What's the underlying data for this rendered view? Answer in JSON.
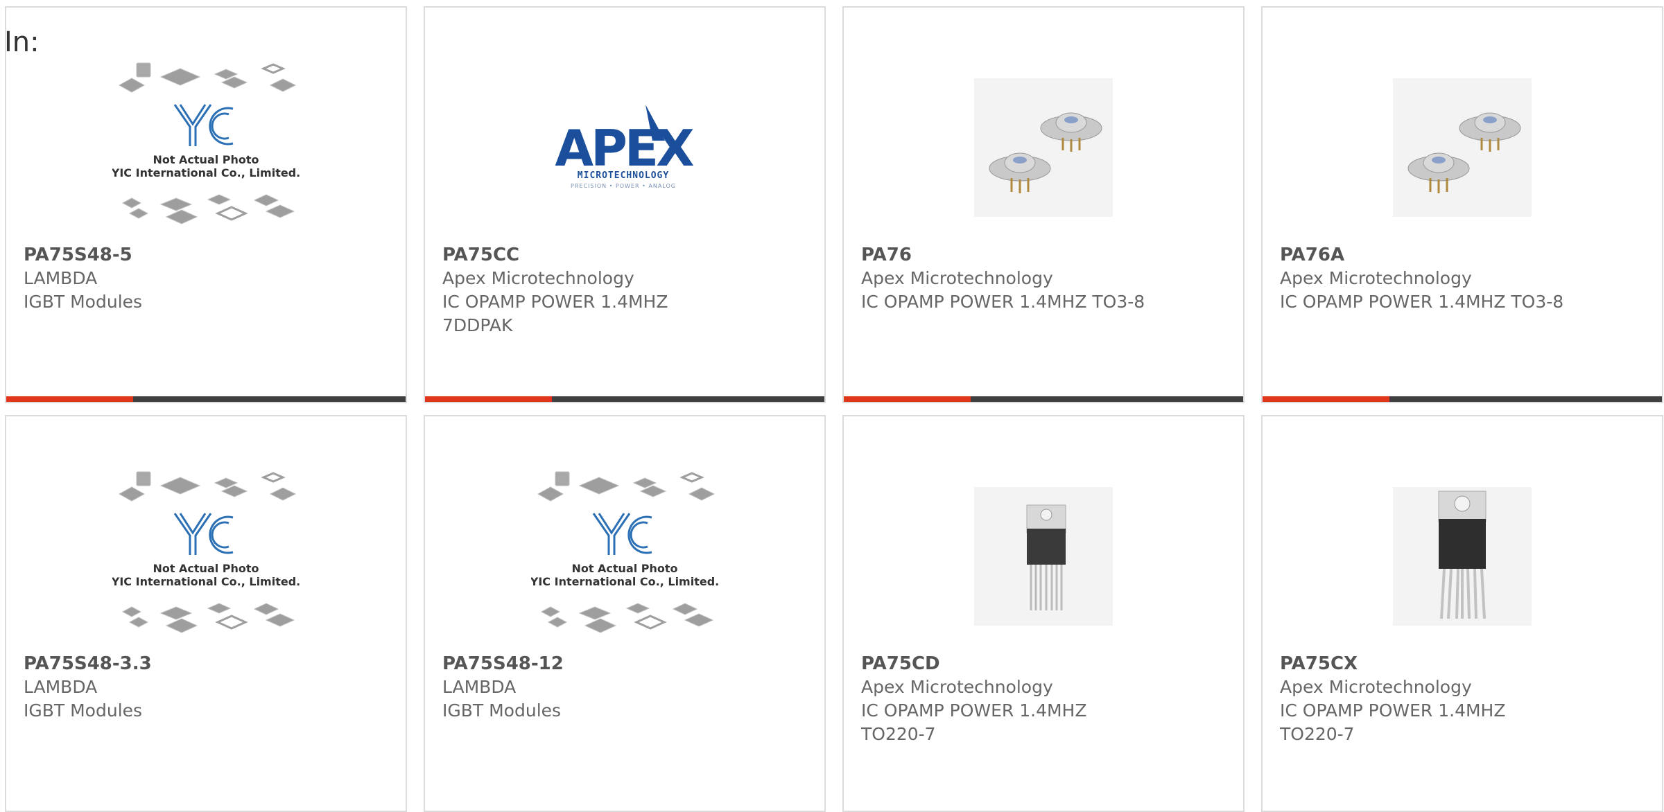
{
  "page": {
    "label": "In:"
  },
  "theme": {
    "accent": "#e2361c",
    "bar": "#404040",
    "border": "#dcdcdc",
    "text": "#666666"
  },
  "products": [
    {
      "part": "PA75S48-5",
      "manufacturer": "LAMBDA",
      "description": "IGBT Modules",
      "image": "yic-placeholder-photo",
      "image_caption": [
        "Not Actual Photo",
        "YIC International Co., Limited."
      ],
      "image_logo": "YIC"
    },
    {
      "part": "PA75CC",
      "manufacturer": "Apex Microtechnology",
      "description": "IC OPAMP POWER 1.4MHZ 7DDPAK",
      "image": "apex-logo",
      "image_logo": "APEX",
      "image_sub": "MICROTECHNOLOGY",
      "image_tagline": "PRECISION • POWER • ANALOG"
    },
    {
      "part": "PA76",
      "manufacturer": "Apex Microtechnology",
      "description": "IC OPAMP POWER 1.4MHZ TO3-8",
      "image": "to3-package-photo"
    },
    {
      "part": "PA76A",
      "manufacturer": "Apex Microtechnology",
      "description": "IC OPAMP POWER 1.4MHZ TO3-8",
      "image": "to3-package-photo"
    },
    {
      "part": "PA75S48-3.3",
      "manufacturer": "LAMBDA",
      "description": "IGBT Modules",
      "image": "yic-placeholder-photo",
      "image_caption": [
        "Not Actual Photo",
        "YIC International Co., Limited."
      ],
      "image_logo": "YIC"
    },
    {
      "part": "PA75S48-12",
      "manufacturer": "LAMBDA",
      "description": "IGBT Modules",
      "image": "yic-placeholder-photo",
      "image_caption": [
        "Not Actual Photo",
        "YIC International Co., Limited."
      ],
      "image_logo": "YIC"
    },
    {
      "part": "PA75CD",
      "manufacturer": "Apex Microtechnology",
      "description": "IC OPAMP POWER 1.4MHZ TO220-7",
      "image": "to220-package-photo"
    },
    {
      "part": "PA75CX",
      "manufacturer": "Apex Microtechnology",
      "description": "IC OPAMP POWER 1.4MHZ TO220-7",
      "image": "to220-package-photo"
    }
  ]
}
